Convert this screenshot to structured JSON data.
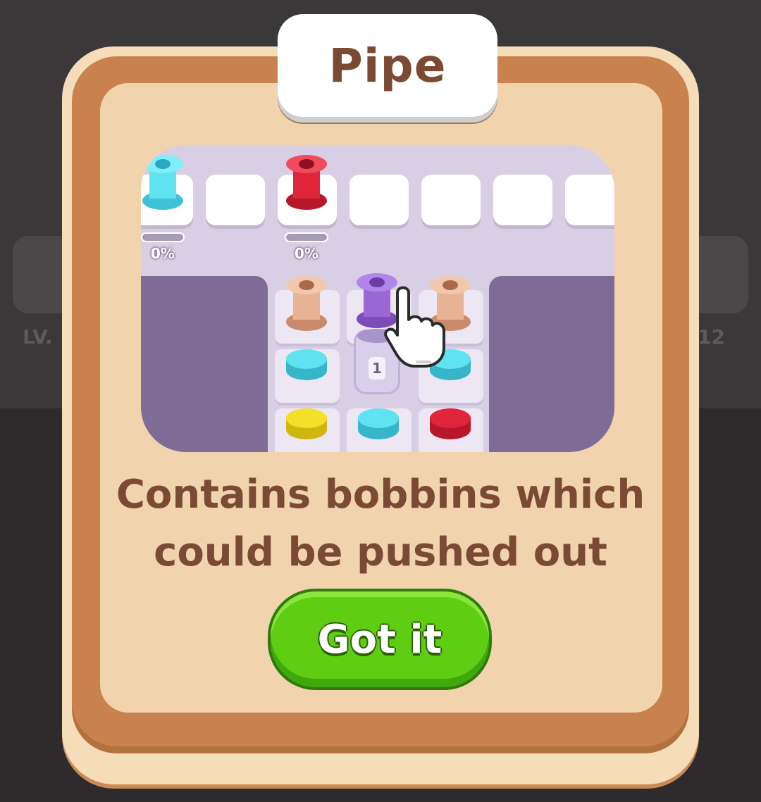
{
  "background": {
    "level_left": "LV.",
    "level_right": "12"
  },
  "popup": {
    "title": "Pipe",
    "description_line1": "Contains bobbins which",
    "description_line2": "could be pushed out",
    "button_label": "Got it"
  },
  "preview": {
    "collector_progress": [
      "0%",
      "0%"
    ],
    "pipe_count": "1"
  },
  "colors": {
    "card_frame": "#c9824d",
    "card_inner": "#f1d3ad",
    "title_text": "#7b4a35",
    "button": "#5fce12",
    "cyan": "#5fe3f0",
    "red": "#e0243a",
    "purple": "#9a67d6",
    "yellow": "#f3e028",
    "tan": "#e7b394"
  }
}
